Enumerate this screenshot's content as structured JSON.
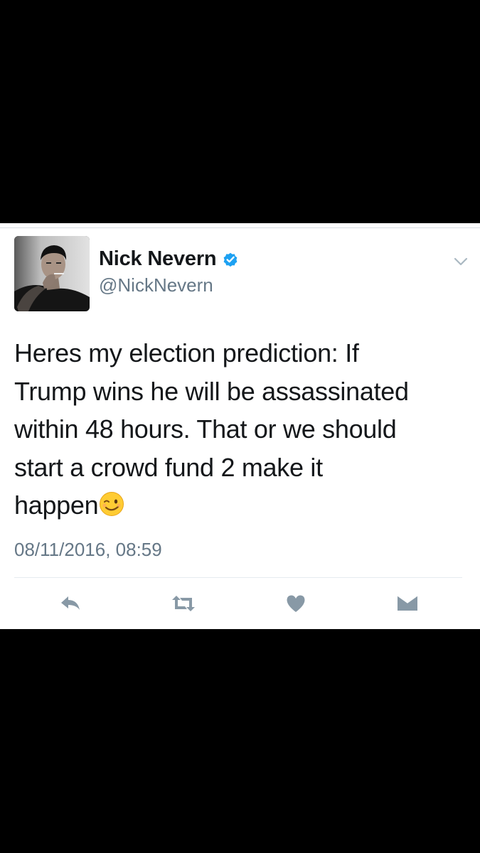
{
  "tweet": {
    "author_name": "Nick Nevern",
    "author_handle": "@NickNevern",
    "verified": true,
    "text_lines": [
      "Heres my election prediction: If",
      "Trump wins he will be assassinated",
      "within 48 hours. That or we should",
      "start a crowd fund 2 make it",
      "happen"
    ],
    "text_emoji": "winking-face-emoji",
    "timestamp": "08/11/2016, 08:59"
  },
  "icons": {
    "verified": "verified-badge-icon",
    "menu": "chevron-down-icon",
    "reply": "reply-icon",
    "retweet": "retweet-icon",
    "like": "heart-icon",
    "message": "envelope-icon"
  },
  "colors": {
    "verified_blue": "#1da1f2",
    "action_icon": "#8899a6",
    "text": "#14171a",
    "muted": "#657786",
    "background_band": "#000000",
    "card": "#ffffff"
  }
}
